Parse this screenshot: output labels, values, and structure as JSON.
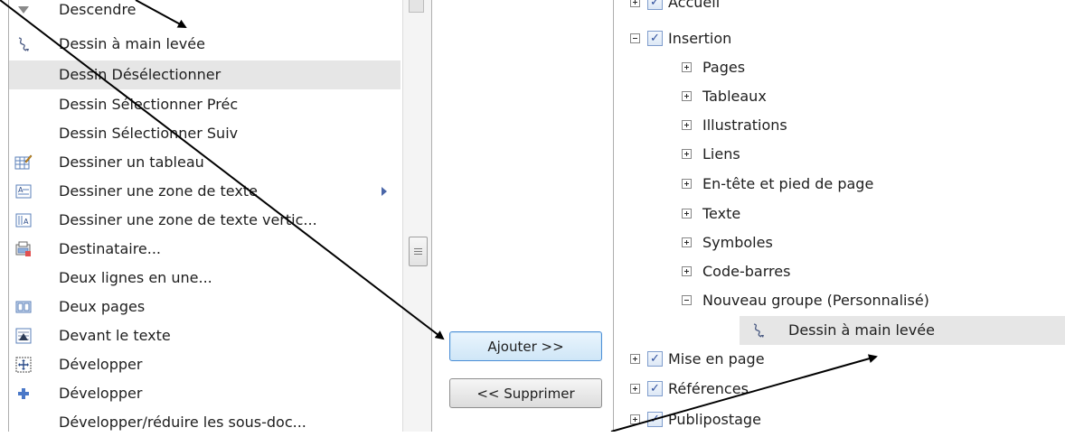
{
  "command_list": {
    "items": [
      {
        "label": "Descendre",
        "icon": "descend-arrow-icon",
        "has_submenu": false,
        "selected": false
      },
      {
        "label": "Dessin à main levée",
        "icon": "freehand-draw-icon",
        "has_submenu": false,
        "selected": false
      },
      {
        "label": "Dessin Désélectionner",
        "icon": "",
        "has_submenu": false,
        "selected": true
      },
      {
        "label": "Dessin Sélectionner Préc",
        "icon": "",
        "has_submenu": false,
        "selected": false
      },
      {
        "label": "Dessin Sélectionner Suiv",
        "icon": "",
        "has_submenu": false,
        "selected": false
      },
      {
        "label": "Dessiner un tableau",
        "icon": "draw-table-icon",
        "has_submenu": false,
        "selected": false
      },
      {
        "label": "Dessiner une zone de texte",
        "icon": "text-box-icon",
        "has_submenu": true,
        "selected": false
      },
      {
        "label": "Dessiner une zone de texte vertic...",
        "icon": "vertical-text-box-icon",
        "has_submenu": false,
        "selected": false
      },
      {
        "label": "Destinataire...",
        "icon": "recipient-icon",
        "has_submenu": false,
        "selected": false
      },
      {
        "label": "Deux lignes en une...",
        "icon": "",
        "has_submenu": false,
        "selected": false
      },
      {
        "label": "Deux pages",
        "icon": "two-pages-icon",
        "has_submenu": false,
        "selected": false
      },
      {
        "label": "Devant le texte",
        "icon": "in-front-of-text-icon",
        "has_submenu": false,
        "selected": false
      },
      {
        "label": "Développer",
        "icon": "expand-dotted-icon",
        "has_submenu": false,
        "selected": false
      },
      {
        "label": "Développer",
        "icon": "plus-icon",
        "has_submenu": false,
        "selected": false
      },
      {
        "label": "Développer/réduire les sous-doc...",
        "icon": "",
        "has_submenu": false,
        "selected": false
      }
    ]
  },
  "buttons": {
    "add_label": "Ajouter >>",
    "remove_label": "<< Supprimer"
  },
  "ribbon_tree": {
    "items": [
      {
        "label": "Accueil",
        "level": 0,
        "expander": "plus",
        "checked": true
      },
      {
        "label": "Insertion",
        "level": 0,
        "expander": "minus",
        "checked": true
      },
      {
        "label": "Pages",
        "level": 1,
        "expander": "plus"
      },
      {
        "label": "Tableaux",
        "level": 1,
        "expander": "plus"
      },
      {
        "label": "Illustrations",
        "level": 1,
        "expander": "plus"
      },
      {
        "label": "Liens",
        "level": 1,
        "expander": "plus"
      },
      {
        "label": "En-tête et pied de page",
        "level": 1,
        "expander": "plus"
      },
      {
        "label": "Texte",
        "level": 1,
        "expander": "plus"
      },
      {
        "label": "Symboles",
        "level": 1,
        "expander": "plus"
      },
      {
        "label": "Code-barres",
        "level": 1,
        "expander": "plus"
      },
      {
        "label": "Nouveau groupe (Personnalisé)",
        "level": 1,
        "expander": "minus"
      },
      {
        "label": "Dessin à main levée",
        "level": 2,
        "icon": "freehand-draw-icon",
        "selected": true
      },
      {
        "label": "Mise en page",
        "level": 0,
        "expander": "plus",
        "checked": true
      },
      {
        "label": "Références",
        "level": 0,
        "expander": "plus",
        "checked": true
      },
      {
        "label": "Publipostage",
        "level": 0,
        "expander": "plus",
        "checked": true
      }
    ]
  },
  "colors": {
    "selection_bg": "#e6e6e6",
    "checkbox_tick": "#2f4f9d",
    "add_button_border": "#4b8ed6"
  }
}
